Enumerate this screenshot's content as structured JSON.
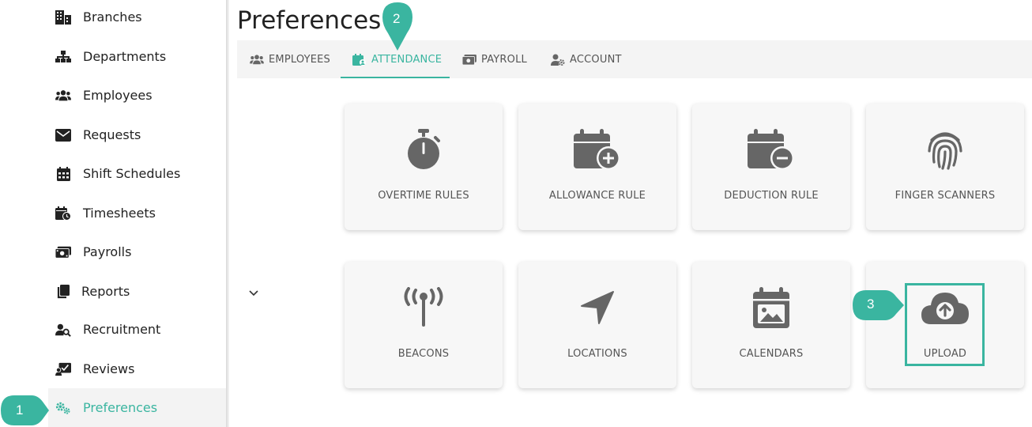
{
  "sidebar": {
    "items": [
      {
        "label": "Branches",
        "icon": "building-icon"
      },
      {
        "label": "Departments",
        "icon": "sitemap-icon"
      },
      {
        "label": "Employees",
        "icon": "users-icon"
      },
      {
        "label": "Requests",
        "icon": "envelope-icon"
      },
      {
        "label": "Shift Schedules",
        "icon": "calendar-icon"
      },
      {
        "label": "Timesheets",
        "icon": "calendar-clock-icon"
      },
      {
        "label": "Payrolls",
        "icon": "money-icon"
      },
      {
        "label": "Reports",
        "icon": "copy-icon"
      },
      {
        "label": "Recruitment",
        "icon": "user-search-icon"
      },
      {
        "label": "Reviews",
        "icon": "review-icon"
      },
      {
        "label": "Preferences",
        "icon": "gears-icon"
      }
    ]
  },
  "header": {
    "title": "Preferences"
  },
  "tabs": [
    {
      "label": "EMPLOYEES",
      "icon": "users-icon"
    },
    {
      "label": "ATTENDANCE",
      "icon": "calendar-user-icon"
    },
    {
      "label": "PAYROLL",
      "icon": "money-icon"
    },
    {
      "label": "ACCOUNT",
      "icon": "user-gear-icon"
    }
  ],
  "cards": [
    {
      "label": "OVERTIME RULES",
      "icon": "stopwatch-icon"
    },
    {
      "label": "ALLOWANCE RULE",
      "icon": "calendar-plus-icon"
    },
    {
      "label": "DEDUCTION RULE",
      "icon": "calendar-minus-icon"
    },
    {
      "label": "FINGER SCANNERS",
      "icon": "fingerprint-icon"
    },
    {
      "label": "BEACONS",
      "icon": "broadcast-tower-icon"
    },
    {
      "label": "LOCATIONS",
      "icon": "location-arrow-icon"
    },
    {
      "label": "CALENDARS",
      "icon": "calendar-image-icon"
    },
    {
      "label": "UPLOAD",
      "icon": "cloud-upload-icon"
    }
  ],
  "markers": [
    {
      "number": "1"
    },
    {
      "number": "2"
    },
    {
      "number": "3"
    }
  ],
  "colors": {
    "accent": "#3ab5a0",
    "icon": "#666666",
    "text": "#222222"
  }
}
